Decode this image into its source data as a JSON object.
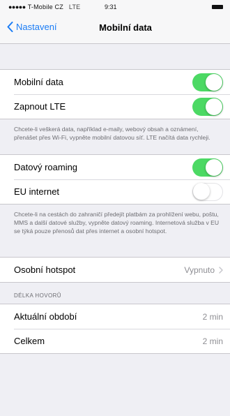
{
  "status_bar": {
    "signal": "●●●●●",
    "carrier": "T-Mobile CZ",
    "network": "LTE",
    "time": "9:31"
  },
  "nav": {
    "back_label": "Nastavení",
    "title": "Mobilní data"
  },
  "group1": {
    "mobile_data": {
      "label": "Mobilní data",
      "enabled": true
    },
    "lte": {
      "label": "Zapnout LTE",
      "enabled": true
    },
    "footnote": "Chcete-li veškerá data, například e-maily, webový obsah a oznámení, přenášet přes Wi-Fi, vypněte mobilní datovou síť. LTE načítá data rychleji."
  },
  "group2": {
    "roaming": {
      "label": "Datový roaming",
      "enabled": true
    },
    "eu_internet": {
      "label": "EU internet",
      "enabled": false
    },
    "footnote": "Chcete-li na cestách do zahraničí předejít platbám za prohlížení webu, poštu, MMS a další datové služby, vypněte datový roaming. Internetová služba v EU se týká pouze přenosů dat přes internet a osobní hotspot."
  },
  "hotspot": {
    "label": "Osobní hotspot",
    "value": "Vypnuto"
  },
  "call_length": {
    "header": "DÉLKA HOVORŮ",
    "current_label": "Aktuální období",
    "current_value": "2 min",
    "total_label": "Celkem",
    "total_value": "2 min"
  },
  "colors": {
    "accent": "#1a7cf5",
    "toggle_on": "#4cd964",
    "background": "#efeff4"
  }
}
